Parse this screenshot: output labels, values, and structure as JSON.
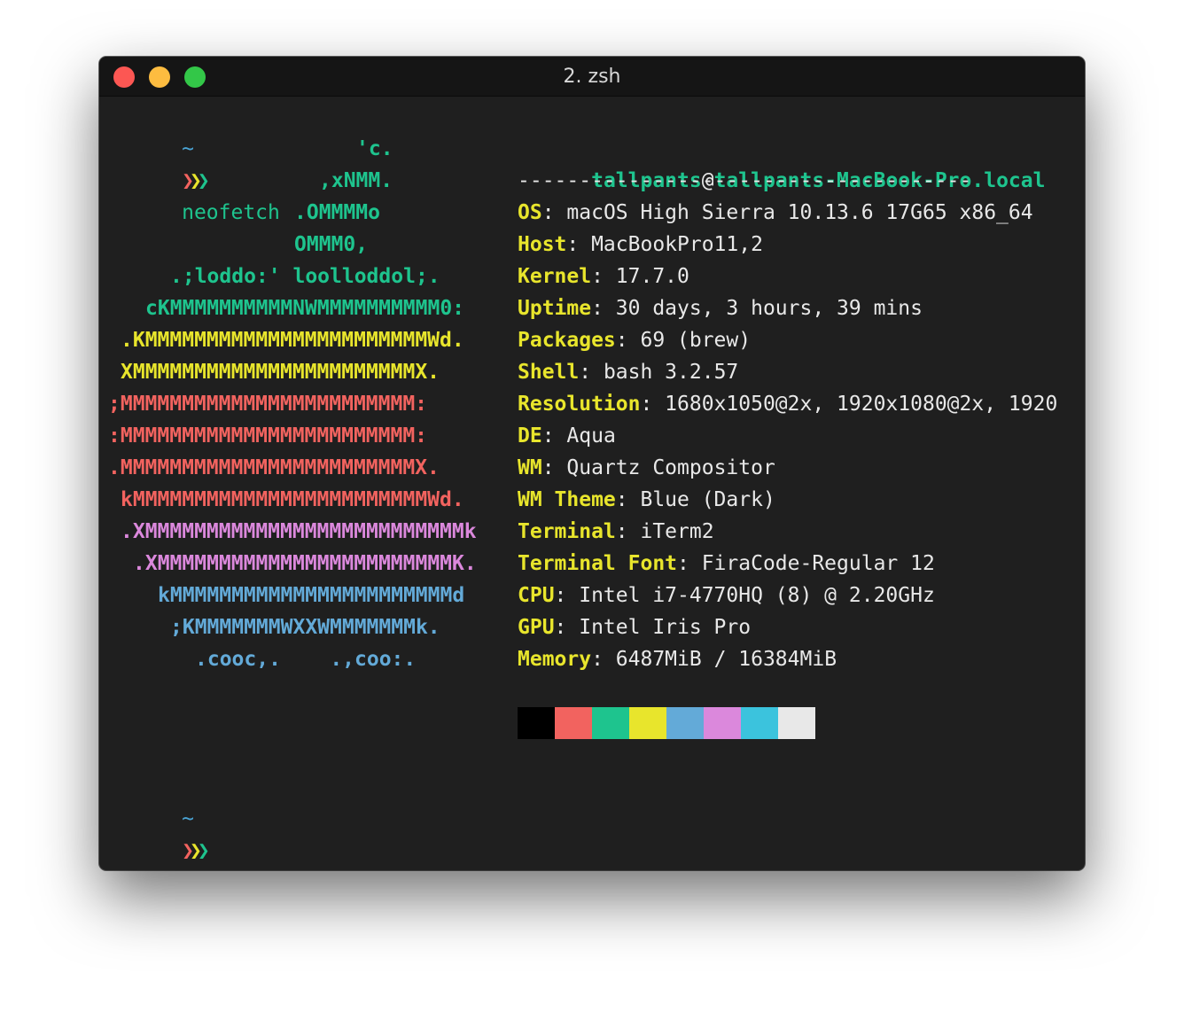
{
  "window": {
    "title": "2. zsh",
    "bg": "#1f1f1f"
  },
  "prompt": {
    "tilde": "~",
    "arrows": [
      "❯",
      "❯",
      "❯"
    ],
    "arrow_colors": [
      "#f2635f",
      "#e8e52c",
      "#1ec48e"
    ],
    "command": "neofetch"
  },
  "logo": [
    {
      "text": "'c.",
      "color": "#1ec48e"
    },
    {
      "text": ",xNMM.",
      "color": "#1ec48e"
    },
    {
      "text": ".OMMMMo",
      "color": "#1ec48e"
    },
    {
      "text": "OMMM0,",
      "color": "#1ec48e"
    },
    {
      "text": ".;loddo:' loolloddol;.",
      "color": "#1ec48e"
    },
    {
      "text": "cKMMMMMMMMMMNWMMMMMMMMMM0:",
      "color": "#1ec48e"
    },
    {
      "text": ".KMMMMMMMMMMMMMMMMMMMMMMMWd.",
      "color": "#e8e52c"
    },
    {
      "text": "XMMMMMMMMMMMMMMMMMMMMMMMX.",
      "color": "#e8e52c"
    },
    {
      "text": ";MMMMMMMMMMMMMMMMMMMMMMMM:",
      "color": "#f2635f"
    },
    {
      "text": ":MMMMMMMMMMMMMMMMMMMMMMMM:",
      "color": "#f2635f"
    },
    {
      "text": ".MMMMMMMMMMMMMMMMMMMMMMMMX.",
      "color": "#f2635f"
    },
    {
      "text": "kMMMMMMMMMMMMMMMMMMMMMMMMWd.",
      "color": "#f2635f"
    },
    {
      "text": ".XMMMMMMMMMMMMMMMMMMMMMMMMMMk",
      "color": "#db88dc"
    },
    {
      "text": ".XMMMMMMMMMMMMMMMMMMMMMMMMK.",
      "color": "#db88dc"
    },
    {
      "text": "kMMMMMMMMMMMMMMMMMMMMMMMd",
      "color": "#63aad8"
    },
    {
      "text": ";KMMMMMMMWXXWMMMMMMMk.",
      "color": "#63aad8"
    },
    {
      "text": ".cooc,.    .,coo:.",
      "color": "#63aad8"
    }
  ],
  "info": {
    "user": "tallpants",
    "at": "@",
    "host": "tallpants-MacBook-Pro.local",
    "separator": "-------------------------------------",
    "fields": [
      {
        "label": "OS",
        "value": ": macOS High Sierra 10.13.6 17G65 x86_64"
      },
      {
        "label": "Host",
        "value": ": MacBookPro11,2"
      },
      {
        "label": "Kernel",
        "value": ": 17.7.0"
      },
      {
        "label": "Uptime",
        "value": ": 30 days, 3 hours, 39 mins"
      },
      {
        "label": "Packages",
        "value": ": 69 (brew)"
      },
      {
        "label": "Shell",
        "value": ": bash 3.2.57"
      },
      {
        "label": "Resolution",
        "value": ": 1680x1050@2x, 1920x1080@2x, 1920"
      },
      {
        "label": "DE",
        "value": ": Aqua"
      },
      {
        "label": "WM",
        "value": ": Quartz Compositor"
      },
      {
        "label": "WM Theme",
        "value": ": Blue (Dark)"
      },
      {
        "label": "Terminal",
        "value": ": iTerm2"
      },
      {
        "label": "Terminal Font",
        "value": ": FiraCode-Regular 12"
      },
      {
        "label": "CPU",
        "value": ": Intel i7-4770HQ (8) @ 2.20GHz"
      },
      {
        "label": "GPU",
        "value": ": Intel Iris Pro"
      },
      {
        "label": "Memory",
        "value": ": 6487MiB / 16384MiB"
      }
    ]
  },
  "palette": [
    "#000000",
    "#f2635f",
    "#1ec48e",
    "#e8e52c",
    "#63aad8",
    "#db88dc",
    "#3bc3dd",
    "#e8e8e8"
  ],
  "prompt2": {
    "tilde": "~",
    "arrows": [
      "❯",
      "❯",
      "❯"
    ]
  }
}
